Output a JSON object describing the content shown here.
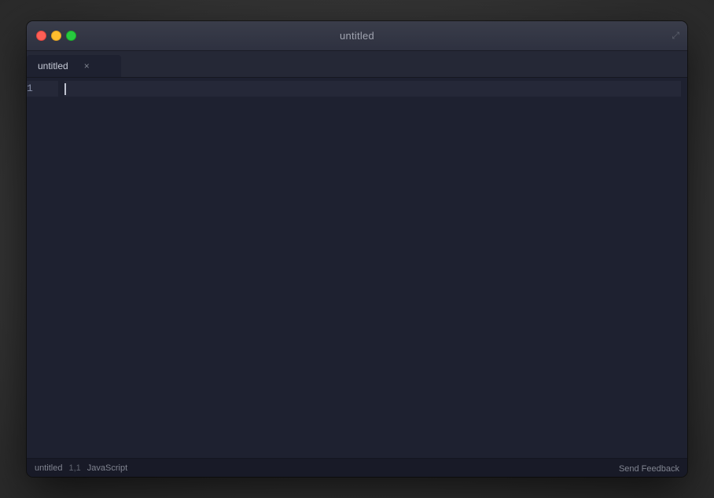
{
  "titleBar": {
    "title": "untitled",
    "expandIcon": "⤢"
  },
  "tab": {
    "label": "untitled",
    "closeLabel": "×"
  },
  "editor": {
    "lineNumbers": [
      1
    ],
    "activeLineNumber": 1,
    "content": ""
  },
  "statusBar": {
    "filename": "untitled",
    "position": "1,1",
    "language": "JavaScript",
    "sendFeedback": "Send Feedback"
  },
  "trafficLights": {
    "closeTitle": "close",
    "minimizeTitle": "minimize",
    "maximizeTitle": "maximize"
  }
}
